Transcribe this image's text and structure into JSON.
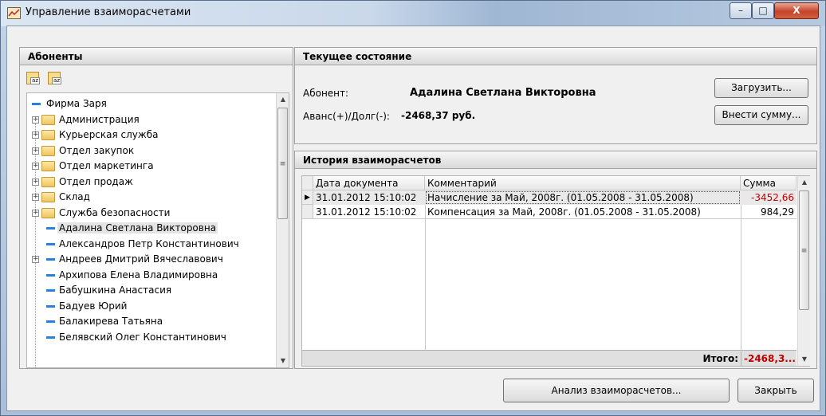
{
  "window": {
    "title": "Управление взаиморасчетами",
    "min_glyph": "–",
    "max_glyph": "□",
    "close_glyph": "X"
  },
  "subscribers": {
    "header": "Абоненты",
    "tree": [
      {
        "label": "Фирма Заря",
        "kind": "root"
      },
      {
        "label": "Администрация",
        "kind": "folder"
      },
      {
        "label": "Курьерская служба",
        "kind": "folder"
      },
      {
        "label": "Отдел закупок",
        "kind": "folder"
      },
      {
        "label": "Отдел маркетинга",
        "kind": "folder"
      },
      {
        "label": "Отдел продаж",
        "kind": "folder"
      },
      {
        "label": "Склад",
        "kind": "folder"
      },
      {
        "label": "Служба безопасности",
        "kind": "folder"
      },
      {
        "label": "Адалина Светлана Викторовна",
        "kind": "person",
        "selected": true
      },
      {
        "label": "Александров Петр Константинович",
        "kind": "person"
      },
      {
        "label": "Андреев Дмитрий Вячеславович",
        "kind": "person-expand"
      },
      {
        "label": "Архипова Елена Владимировна",
        "kind": "person"
      },
      {
        "label": "Бабушкина Анастасия",
        "kind": "person"
      },
      {
        "label": "Бадуев Юрий",
        "kind": "person"
      },
      {
        "label": "Балакирева Татьяна",
        "kind": "person"
      },
      {
        "label": "Белявский Олег Константинович",
        "kind": "person"
      }
    ]
  },
  "current_state": {
    "header": "Текущее состояние",
    "subscriber_label": "Абонент:",
    "subscriber_value": "Адалина Светлана Викторовна",
    "balance_label": "Аванс(+)/Долг(-):",
    "balance_value": "-2468,37 руб.",
    "load_button": "Загрузить...",
    "deposit_button": "Внести сумму..."
  },
  "history": {
    "header": "История взаиморасчетов",
    "columns": [
      "Дата документа",
      "Комментарий",
      "Сумма"
    ],
    "rows": [
      {
        "date": "31.01.2012 15:10:02",
        "comment": "Начисление за Май, 2008г. (01.05.2008 - 31.05.2008)",
        "amount": "-3452,66",
        "current": true
      },
      {
        "date": "31.01.2012 15:10:02",
        "comment": "Компенсация за Май, 2008г. (01.05.2008 - 31.05.2008)",
        "amount": "984,29",
        "current": false
      }
    ],
    "total_label": "Итого:",
    "total_value": "-2468,3..."
  },
  "footer": {
    "analyze_button": "Анализ взаиморасчетов...",
    "close_button": "Закрыть"
  },
  "colors": {
    "negative": "#c00000",
    "accent": "#4f6fa0"
  }
}
